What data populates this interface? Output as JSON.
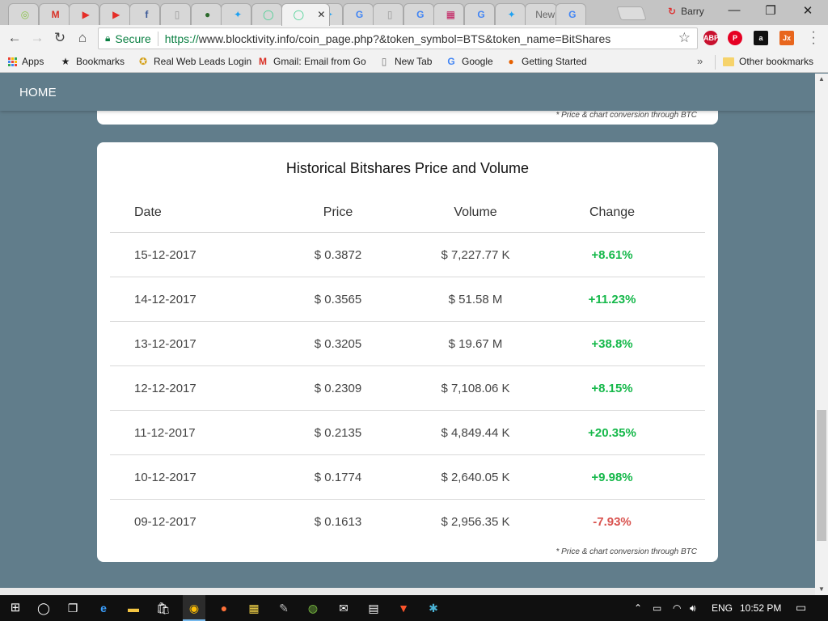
{
  "browser": {
    "tabs": [
      {
        "icon": "chrome-loading-icon",
        "color": "#8bc34a",
        "glyph": "◎"
      },
      {
        "icon": "gmail-icon",
        "color": "#d93025",
        "glyph": "M"
      },
      {
        "icon": "youtube-icon",
        "color": "#e52d27",
        "glyph": "▶"
      },
      {
        "icon": "youtube-icon",
        "color": "#e52d27",
        "glyph": "▶"
      },
      {
        "icon": "facebook-icon",
        "color": "#3b5998",
        "glyph": "f"
      },
      {
        "icon": "document-icon",
        "color": "#999999",
        "glyph": "▯"
      },
      {
        "icon": "dark-circle-icon",
        "color": "#2d6b2d",
        "glyph": "●"
      },
      {
        "icon": "twitter-icon",
        "color": "#1da1f2",
        "glyph": "✦"
      },
      {
        "icon": "green-circle-icon",
        "color": "#3fcf8e",
        "glyph": "◯"
      },
      {
        "icon": "green-circle-icon",
        "color": "#3fcf8e",
        "glyph": "◯"
      },
      {
        "icon": "twitter-icon",
        "color": "#1da1f2",
        "glyph": "✦"
      },
      {
        "icon": "google-icon",
        "color": "#4285f4",
        "glyph": "G"
      },
      {
        "icon": "document-icon",
        "color": "#999999",
        "glyph": "▯"
      },
      {
        "icon": "google-icon",
        "color": "#4285f4",
        "glyph": "G"
      },
      {
        "icon": "grid-app-icon",
        "color": "#c2185b",
        "glyph": "▦"
      },
      {
        "icon": "google-icon",
        "color": "#4285f4",
        "glyph": "G"
      },
      {
        "icon": "twitter-icon",
        "color": "#1da1f2",
        "glyph": "✦"
      },
      {
        "icon": "new-tab-icon",
        "color": "#888888",
        "glyph": "",
        "label": "New"
      },
      {
        "icon": "google-icon",
        "color": "#4285f4",
        "glyph": "G"
      }
    ],
    "active_tab_close": "✕",
    "profile_name": "Barry",
    "window_controls": {
      "minimize": "—",
      "restore": "❐",
      "close": "✕"
    },
    "secure_label": "Secure",
    "url_scheme": "https://",
    "url_rest": "www.blocktivity.info/coin_page.php?&token_symbol=BTS&token_name=BitShares",
    "extensions": [
      {
        "name": "abp-icon",
        "label": "ABP",
        "color": "#c8102e"
      },
      {
        "name": "pinterest-icon",
        "label": "P",
        "color": "#e60023"
      },
      {
        "name": "amazon-icon",
        "label": "a",
        "color": "#111111"
      },
      {
        "name": "jx-icon",
        "label": "Jx",
        "color": "#e8661d"
      }
    ],
    "bookmarks": [
      {
        "label": "Apps"
      },
      {
        "label": "Bookmarks"
      },
      {
        "label": "Real Web Leads Login"
      },
      {
        "label": "Gmail: Email from Go"
      },
      {
        "label": "New Tab"
      },
      {
        "label": "Google"
      },
      {
        "label": "Getting Started"
      }
    ],
    "other_bookmarks": "Other bookmarks"
  },
  "page": {
    "nav_home": "HOME",
    "top_note": "* Price & chart conversion through BTC",
    "table_title": "Historical Bitshares Price and Volume",
    "headers": [
      "Date",
      "Price",
      "Volume",
      "Change"
    ],
    "rows": [
      {
        "date": "15-12-2017",
        "price": "$ 0.3872",
        "volume": "$ 7,227.77 K",
        "change": "+8.61%",
        "dir": "pos"
      },
      {
        "date": "14-12-2017",
        "price": "$ 0.3565",
        "volume": "$ 51.58 M",
        "change": "+11.23%",
        "dir": "pos"
      },
      {
        "date": "13-12-2017",
        "price": "$ 0.3205",
        "volume": "$ 19.67 M",
        "change": "+38.8%",
        "dir": "pos"
      },
      {
        "date": "12-12-2017",
        "price": "$ 0.2309",
        "volume": "$ 7,108.06 K",
        "change": "+8.15%",
        "dir": "pos"
      },
      {
        "date": "11-12-2017",
        "price": "$ 0.2135",
        "volume": "$ 4,849.44 K",
        "change": "+20.35%",
        "dir": "pos"
      },
      {
        "date": "10-12-2017",
        "price": "$ 0.1774",
        "volume": "$ 2,640.05 K",
        "change": "+9.98%",
        "dir": "pos"
      },
      {
        "date": "09-12-2017",
        "price": "$ 0.1613",
        "volume": "$ 2,956.35 K",
        "change": "-7.93%",
        "dir": "neg"
      }
    ],
    "bottom_note": "* Price & chart conversion through BTC",
    "colors": {
      "positive": "#15b84a",
      "negative": "#d9534f",
      "background": "#617d8b"
    }
  },
  "taskbar": {
    "language": "ENG",
    "time": "10:52 PM"
  }
}
